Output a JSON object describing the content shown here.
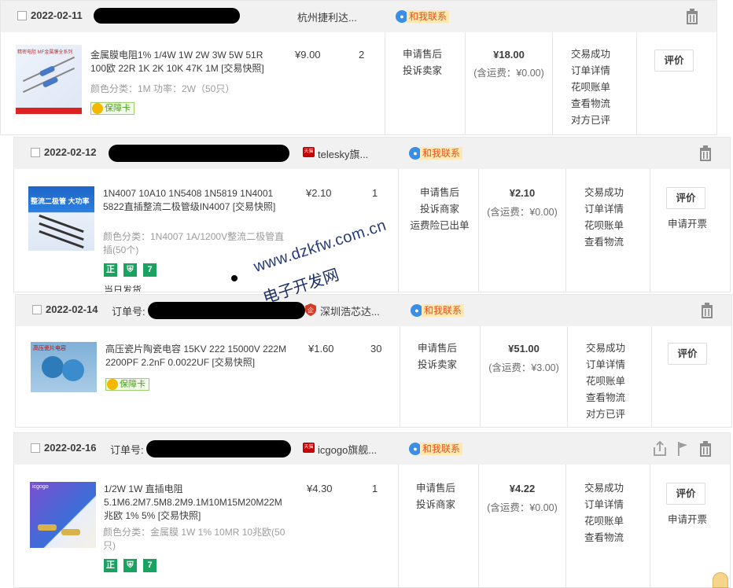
{
  "ui": {
    "contact_label": "和我联系",
    "order_no_label": "订单号:",
    "guarantee_label": "保障卡",
    "review_label": "评价",
    "invoice_label": "申请开票",
    "zheng_label": "正",
    "seven_label": "7",
    "tmall_label": "天猫",
    "shield_label": "企"
  },
  "watermark": {
    "line1": "www.dzkfw.com.cn",
    "line2": "电子开发网"
  },
  "orders": [
    {
      "date": "2022-02-11",
      "shop": "杭州捷利达...",
      "product": {
        "title": "金属膜电阻1% 1/4W 1W 2W 3W 5W 51R 100欧 22R 1K 2K 10K 47K 1M [交易快照]",
        "attr": "颜色分类：1M  功率：2W（50只）",
        "thumb_text": "精密电阻 MF金属膜全系列",
        "price": "¥9.00",
        "qty": "2"
      },
      "service": [
        "申请售后",
        "投诉卖家"
      ],
      "total": "¥18.00",
      "shipping": "(含运费：¥0.00)",
      "status": [
        "交易成功",
        "订单详情",
        "花呗账单",
        "查看物流",
        "对方已评"
      ]
    },
    {
      "date": "2022-02-12",
      "shop": "telesky旗...",
      "product": {
        "title": "1N4007 10A10 1N5408 1N5819 1N4001 5822直插整流二极管级IN4007 [交易快照]",
        "attr": "颜色分类：1N4007 1A/1200V整流二极管直插(50个)",
        "thumb_text": "整流二极管 大功率",
        "price": "¥2.10",
        "qty": "1",
        "extra": "当日发货"
      },
      "service": [
        "申请售后",
        "投诉商家",
        "运费险已出单"
      ],
      "total": "¥2.10",
      "shipping": "(含运费：¥0.00)",
      "status": [
        "交易成功",
        "订单详情",
        "花呗账单",
        "查看物流"
      ]
    },
    {
      "date": "2022-02-14",
      "shop": "深圳浩芯达...",
      "product": {
        "title": "高压瓷片陶瓷电容 15KV 222 15000V 222M 2200PF 2.2nF 0.0022UF [交易快照]",
        "thumb_text": "高压瓷片电容",
        "price": "¥1.60",
        "qty": "30"
      },
      "service": [
        "申请售后",
        "投诉卖家"
      ],
      "total": "¥51.00",
      "shipping": "(含运费：¥3.00)",
      "status": [
        "交易成功",
        "订单详情",
        "花呗账单",
        "查看物流",
        "对方已评"
      ]
    },
    {
      "date": "2022-02-16",
      "shop": "icgogo旗舰...",
      "product": {
        "title": "1/2W 1W 直插电阻 5.1M6.2M7.5M8.2M9.1M10M15M20M22M 兆欧 1% 5% [交易快照]",
        "attr": "颜色分类：金属膜 1W 1% 10MR 10兆欧(50只)",
        "thumb_text": "icgogo",
        "price": "¥4.30",
        "qty": "1"
      },
      "service": [
        "申请售后",
        "投诉商家"
      ],
      "total": "¥4.22",
      "shipping": "(含运费：¥0.00)",
      "status": [
        "交易成功",
        "订单详情",
        "花呗账单",
        "查看物流"
      ]
    }
  ]
}
